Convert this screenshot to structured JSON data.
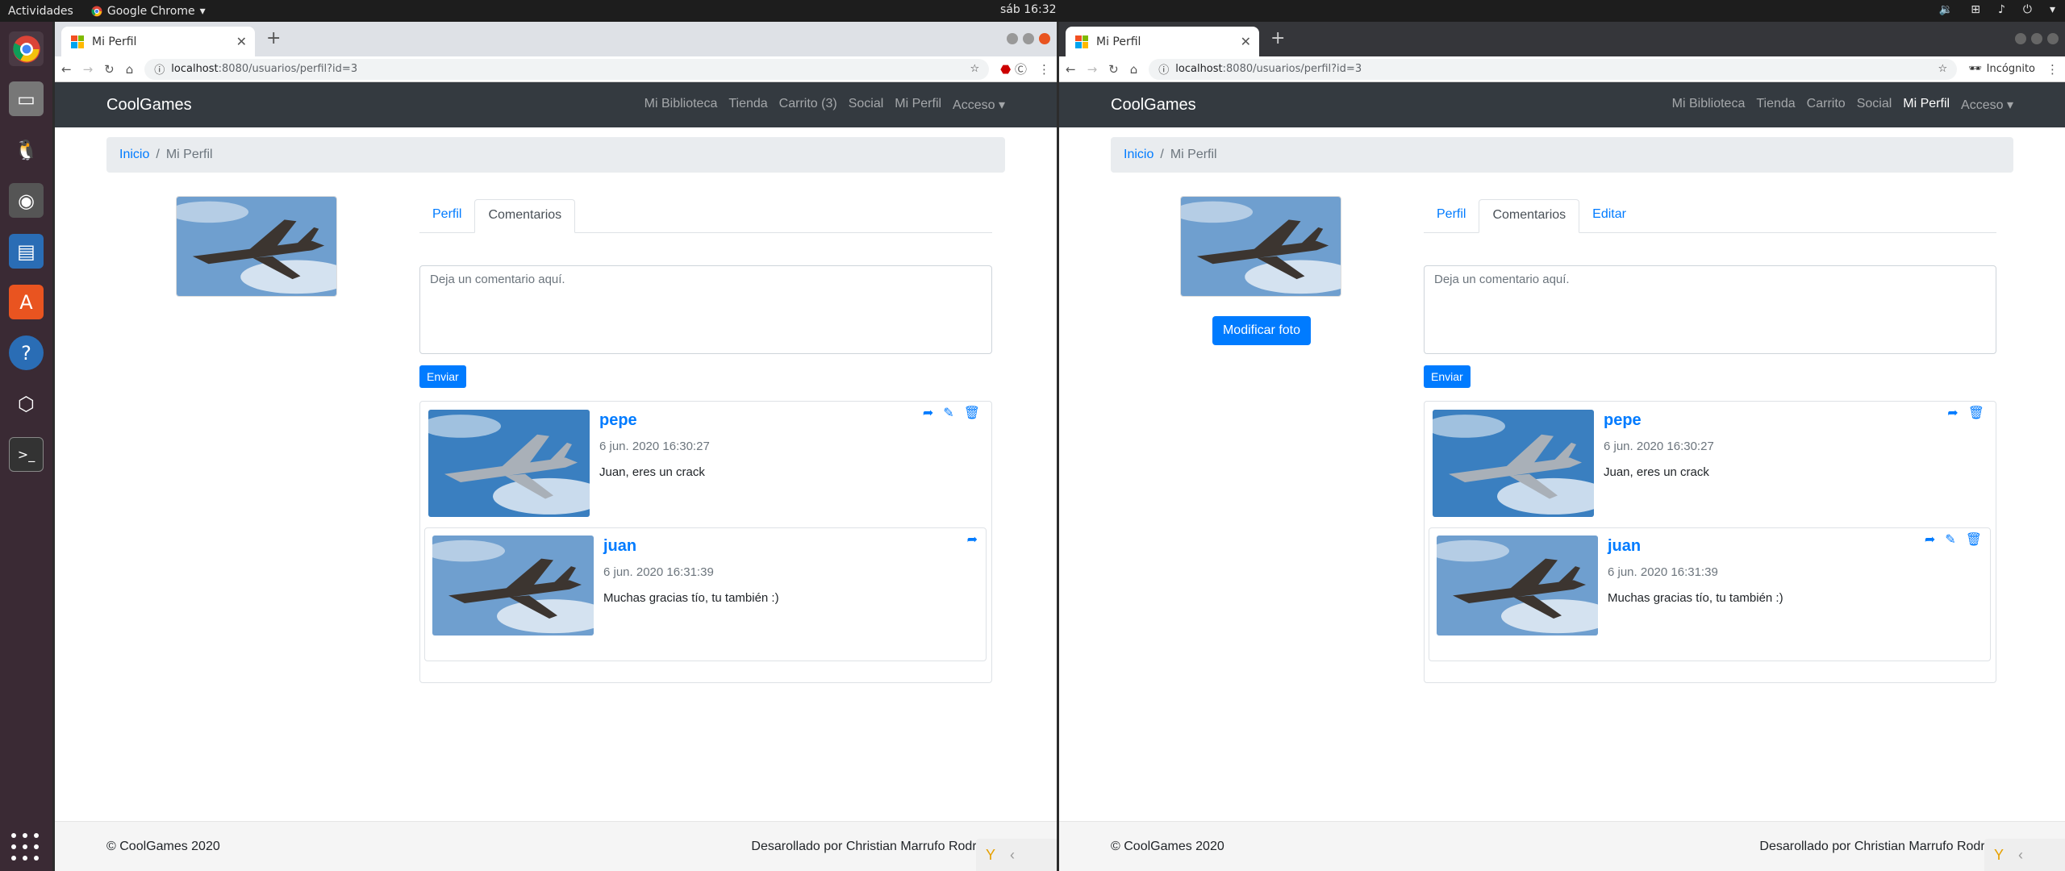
{
  "os": {
    "activities": "Actividades",
    "app_menu": "Google Chrome",
    "clock": "sáb 16:32"
  },
  "windows": [
    {
      "tab_title": "Mi Perfil",
      "url_domain": "localhost",
      "url_path": ":8080/usuarios/perfil?id=3",
      "incognito": "",
      "brand": "CoolGames",
      "nav": [
        "Mi Biblioteca",
        "Tienda",
        "Carrito (3)",
        "Social",
        "Mi Perfil",
        "Acceso ▾"
      ],
      "nav_active_index": -1,
      "breadcrumb": {
        "home": "Inicio",
        "current": "Mi Perfil"
      },
      "modify_photo": "",
      "tabs": [
        "Perfil",
        "Comentarios"
      ],
      "textarea_placeholder": "Deja un comentario aquí.",
      "send_label": "Enviar",
      "comments": [
        {
          "user": "pepe",
          "date": "6 jun. 2020 16:30:27",
          "text": "Juan, eres un crack"
        },
        {
          "user": "juan",
          "date": "6 jun. 2020 16:31:39",
          "text": "Muchas gracias tío, tu también :)"
        }
      ],
      "footer_left": "© CoolGames 2020",
      "footer_right": "Desarollado por Christian Marrufo Rodríg"
    },
    {
      "tab_title": "Mi Perfil",
      "url_domain": "localhost",
      "url_path": ":8080/usuarios/perfil?id=3",
      "incognito": "Incógnito",
      "brand": "CoolGames",
      "nav": [
        "Mi Biblioteca",
        "Tienda",
        "Carrito",
        "Social",
        "Mi Perfil",
        "Acceso ▾"
      ],
      "nav_active_index": 4,
      "breadcrumb": {
        "home": "Inicio",
        "current": "Mi Perfil"
      },
      "modify_photo": "Modificar foto",
      "tabs": [
        "Perfil",
        "Comentarios",
        "Editar"
      ],
      "textarea_placeholder": "Deja un comentario aquí.",
      "send_label": "Enviar",
      "comments": [
        {
          "user": "pepe",
          "date": "6 jun. 2020 16:30:27",
          "text": "Juan, eres un crack"
        },
        {
          "user": "juan",
          "date": "6 jun. 2020 16:31:39",
          "text": "Muchas gracias tío, tu también :)"
        }
      ],
      "footer_left": "© CoolGames 2020",
      "footer_right": "Desarollado por Christian Marrufo Rodríg"
    }
  ]
}
